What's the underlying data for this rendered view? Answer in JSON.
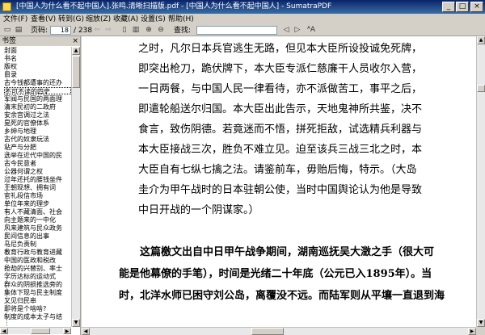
{
  "window": {
    "title": "[中国人为什么看不起中国人].张鸣.清晰扫描版.pdf - [中国人为什么看不起中国人] - SumatraPDF"
  },
  "menu": [
    {
      "label": "文件(F)"
    },
    {
      "label": "查看(V)"
    },
    {
      "label": "转到(G)"
    },
    {
      "label": "缩放(Z)"
    },
    {
      "label": "收藏(A)"
    },
    {
      "label": "设置(S)"
    },
    {
      "label": "帮助(H)"
    }
  ],
  "toolbar": {
    "page_label": "页码:",
    "page_value": "18",
    "page_total": "/ 238",
    "find_label": "查找:",
    "find_value": "",
    "match_case": "ᴬA"
  },
  "sidebar": {
    "title": "书签",
    "items": [
      "封面",
      "书名",
      "版权",
      "目录",
      "古今钱都遭事的还办",
      "不可不读的四史",
      "军阀与民国的两面理",
      "清末民初的二政府",
      "安余宫调过之法",
      "晃死的官僚体系",
      "乡绅与地理",
      "古代的奴隶玩法",
      "站产与分肥",
      "选举在近代中国的民",
      "古今民意者",
      "公器何谓之权",
      "过年还托的腰钱坐件",
      "王朝现想、拥有词",
      "官礼段信市场",
      "单位年来的理步",
      "有人不藏清面、社会",
      "向主题来的一中化",
      "风来建筑与民众政务",
      "民间信息的出事",
      "马尼负责制",
      "教育行政与教育进藏",
      "中国的医政和税改",
      "抢劫的兴替别、率士",
      "学历达标的运动式",
      "群众的阴损推选旁的",
      "集体下现与民主制度",
      "又见归民串",
      "即将是个啥啥?",
      "制度的成本太子与结"
    ]
  },
  "document": {
    "lines": [
      "之时，凡尔日本兵官逃生无路，但见本大臣所设投诚免死牌，",
      "即突出枪刀，跪伏牌下，本大臣专派仁慈廉干人员收尔入营，",
      "一日两餐，与中国人民一律看待，亦不派做苦工，事平之后，",
      "即遣轮船送尔归国。本大臣出此告示，天地鬼神所共鉴，决不",
      "食言，致伤阴德。若竟迷而不悟，拼死拒敌，试选精兵利器与",
      "本大臣接战三次，胜负不难立见。迫至该兵三战三北之时，本",
      "大臣自有七纵七擒之法。请鉴前车，毋贻后悔，特示。（大岛",
      "圭介为甲午战时的日本驻朝公使，当时中国舆论认为他是导致",
      "中日开战的一个阴谋家。）",
      "　　这篇檄文出自中日甲午战争期间，湖南巡抚吴大澂之手（很大可",
      "能是他幕僚的手笔），时间是光绪二十年底（公元已入1895年）。当",
      "时，北洋水师已困守刘公岛，离覆没不远。而陆军则从平壤一直退到海"
    ]
  }
}
